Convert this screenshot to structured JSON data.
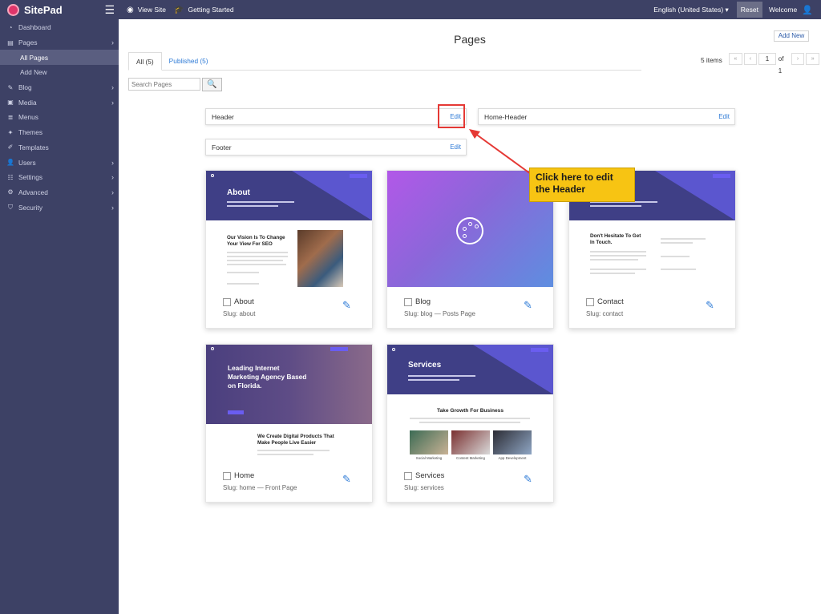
{
  "app": {
    "brand": "SitePad"
  },
  "topbar": {
    "view_site": "View Site",
    "getting_started": "Getting Started",
    "language": "English (United States) ▾",
    "reset": "Reset",
    "welcome": "Welcome"
  },
  "sidebar": {
    "items": [
      {
        "label": "Dashboard",
        "icon": "dashboard-icon"
      },
      {
        "label": "Pages",
        "icon": "pages-icon",
        "chevron": "›"
      },
      {
        "label": "All Pages",
        "sub": true,
        "active": true
      },
      {
        "label": "Add New",
        "sub": true
      },
      {
        "label": "Blog",
        "icon": "pin-icon",
        "chevron": "›"
      },
      {
        "label": "Media",
        "icon": "media-icon",
        "chevron": "›"
      },
      {
        "label": "Menus",
        "icon": "menus-icon"
      },
      {
        "label": "Themes",
        "icon": "themes-icon"
      },
      {
        "label": "Templates",
        "icon": "templates-icon"
      },
      {
        "label": "Users",
        "icon": "users-icon",
        "chevron": "›"
      },
      {
        "label": "Settings",
        "icon": "settings-icon",
        "chevron": "›"
      },
      {
        "label": "Advanced",
        "icon": "gear-icon",
        "chevron": "›"
      },
      {
        "label": "Security",
        "icon": "shield-icon",
        "chevron": "›"
      }
    ]
  },
  "main": {
    "title": "Pages",
    "add_new": "Add New",
    "tabs": [
      {
        "label": "All (5)"
      },
      {
        "label": "Published (5)"
      }
    ],
    "items_count": "5 items",
    "pagination": {
      "first": "«",
      "prev": "‹",
      "current": "1",
      "of": "of 1",
      "next": "›",
      "last": "»"
    },
    "search_placeholder": "Search Pages",
    "search_icon": "🔍",
    "templates": [
      {
        "name": "Header",
        "edit": "Edit"
      },
      {
        "name": "Home-Header",
        "edit": "Edit"
      },
      {
        "name": "Footer",
        "edit": "Edit"
      }
    ],
    "callout": "Click here to edit the Header",
    "cards": [
      {
        "name": "About",
        "slug": "Slug: about",
        "hero": "About",
        "heading": "Our Vision Is To Change Your View For SEO"
      },
      {
        "name": "Blog",
        "slug": "Slug: blog — Posts Page"
      },
      {
        "name": "Contact",
        "slug": "Slug: contact",
        "heading": "Don't Hesitate To Get In Touch."
      },
      {
        "name": "Home",
        "slug": "Slug: home — Front Page",
        "hero": "Leading Internet Marketing Agency Based on Florida.",
        "heading": "We Create Digital Products That Make People Live Easier"
      },
      {
        "name": "Services",
        "slug": "Slug: services",
        "hero": "Services",
        "heading": "Take Growth For Business",
        "tiles": [
          "Social Marketing",
          "Content Marketing",
          "App Development"
        ]
      }
    ]
  },
  "colors": {
    "sidebar": "#3d4165",
    "accent": "#2d7ad6",
    "callout": "#f7c413",
    "highlight": "#e53935"
  }
}
